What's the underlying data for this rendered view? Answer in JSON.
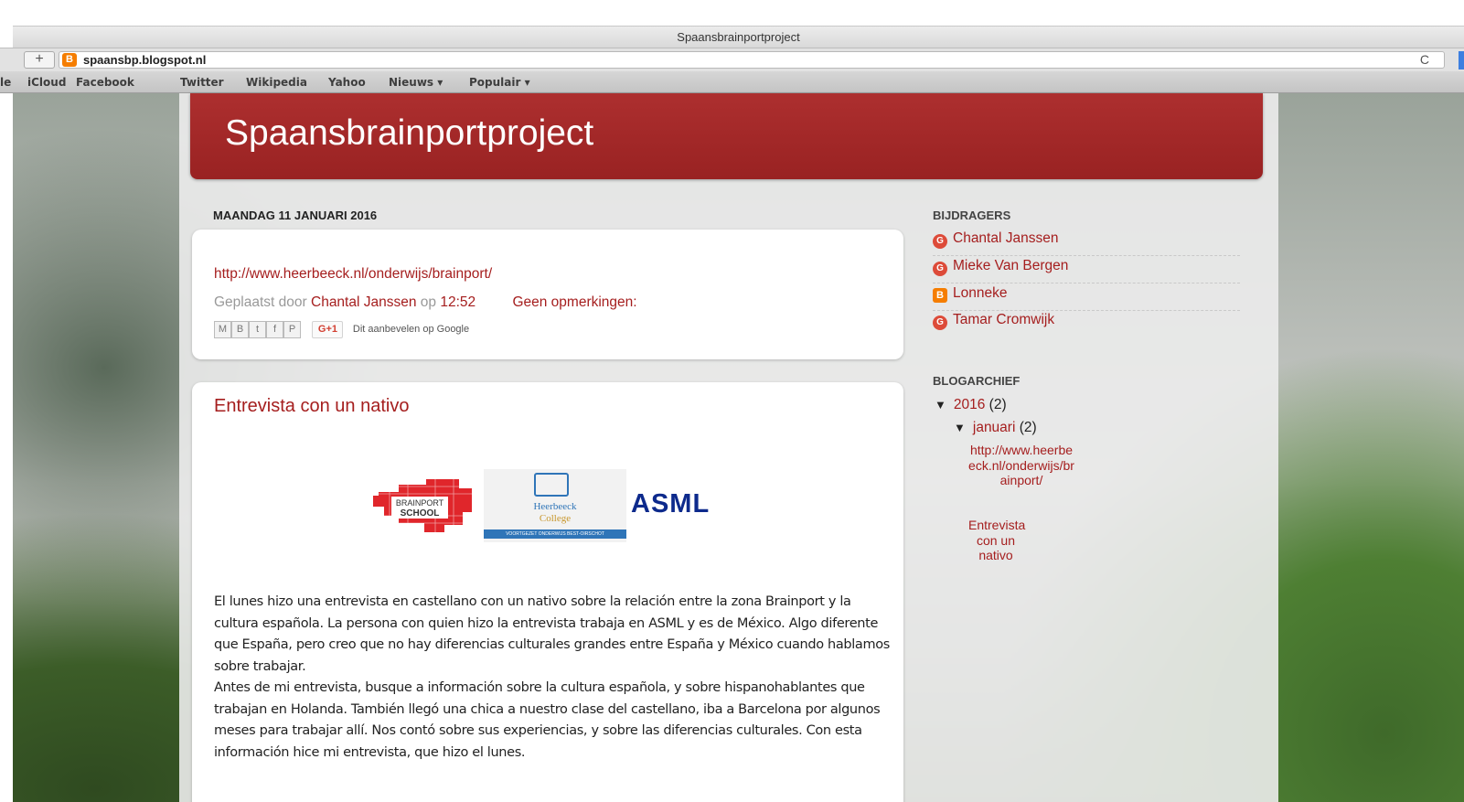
{
  "browser": {
    "window_title": "Spaansbrainportproject",
    "new_tab_symbol": "+",
    "url": "spaansbp.blogspot.nl",
    "reload_symbol": "C",
    "bookmarks": [
      "le",
      "iCloud",
      "Facebook",
      "Twitter",
      "Wikipedia",
      "Yahoo",
      "Nieuws ▾",
      "Populair ▾"
    ]
  },
  "blog": {
    "title": "Spaansbrainportproject",
    "date_header": "MAANDAG 11 JANUARI 2016"
  },
  "post1": {
    "link": "http://www.heerbeeck.nl/onderwijs/brainport/",
    "posted_by_label": "Geplaatst door",
    "author": "Chantal Janssen",
    "at_label": "op",
    "time": "12:52",
    "comments": "Geen opmerkingen:",
    "share_icons": [
      "M",
      "B",
      "t",
      "f",
      "P"
    ],
    "gplus_label": "G+1",
    "recommend_text": "Dit aanbevelen op Google"
  },
  "post2": {
    "title": "Entrevista con un nativo",
    "logos": {
      "brainport_line1": "BRAINPORT",
      "brainport_line2": "SCHOOL",
      "heerbeeck_line1": "Heerbeeck",
      "heerbeeck_line2": "College",
      "heerbeeck_strip": "VOORTGEZET ONDERWIJS BEST-OIRSCHOT",
      "asml": "ASML"
    },
    "paragraph1": "El lunes hizo una entrevista en castellano con un nativo sobre la relación entre la zona Brainport y la cultura española. La persona con quien hizo la entrevista trabaja en ASML y es de México. Algo diferente que España, pero creo que no hay diferencias culturales grandes entre España y México cuando hablamos sobre trabajar.",
    "paragraph2": "Antes de mi entrevista, busque a información sobre la cultura española, y sobre hispanohablantes que trabajan en Holanda. También llegó una chica a nuestro clase del castellano, iba a Barcelona por algunos meses para trabajar allí. Nos contó sobre sus experiencias, y sobre las diferencias culturales. Con esta información hice mi entrevista, que hizo el lunes."
  },
  "sidebar": {
    "contributors_title": "BIJDRAGERS",
    "contributors": [
      {
        "name": "Chantal Janssen",
        "icon": "G"
      },
      {
        "name": "Mieke Van Bergen",
        "icon": "G"
      },
      {
        "name": "Lonneke",
        "icon": "B"
      },
      {
        "name": "Tamar Cromwijk",
        "icon": "G"
      }
    ],
    "archive_title": "BLOGARCHIEF",
    "archive": {
      "toggle": "▼",
      "year": "2016",
      "year_count": "(2)",
      "month": "januari",
      "month_count": "(2)",
      "posts": [
        "http://www.heerbeeck.nl/onderwijs/brainport/",
        "Entrevista con un nativo"
      ]
    }
  },
  "colors": {
    "header_red": "#a52a2a",
    "link_red": "#a51e1e",
    "blogger_orange": "#f57d00",
    "gplus_red": "#dd4b39"
  }
}
